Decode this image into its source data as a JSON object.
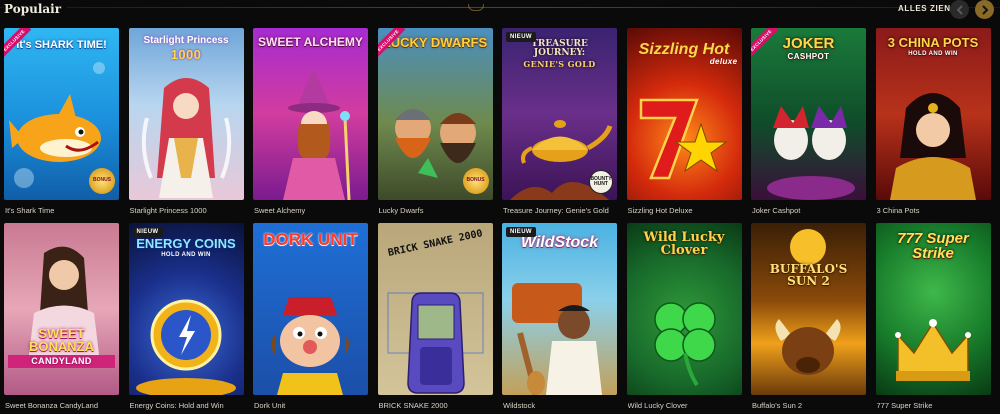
{
  "header": {
    "title": "Populair",
    "see_all_label": "ALLES ZIEN",
    "prev_icon": "chevron-left-icon",
    "next_icon": "chevron-right-icon"
  },
  "badges": {
    "exclusive": "EXCLUSIVE",
    "new": "NIEUW"
  },
  "games": [
    {
      "caption": "It's Shark Time",
      "logo": "It's SHARK TIME!",
      "extra": "BONUS"
    },
    {
      "caption": "Starlight Princess 1000",
      "logo": "Starlight Princess",
      "logo_sub": "1000"
    },
    {
      "caption": "Sweet Alchemy",
      "logo": "SWEET ALCHEMY"
    },
    {
      "caption": "Lucky Dwarfs",
      "logo": "LUCKY DWARFS",
      "extra": "BONUS"
    },
    {
      "caption": "Treasure Journey: Genie's Gold",
      "logo": "TREASURE JOURNEY:",
      "logo_sub": "GENIE'S GOLD",
      "extra": "BOUNTY HUNT"
    },
    {
      "caption": "Sizzling Hot Deluxe",
      "logo": "Sizzling Hot",
      "logo_sub": "deluxe"
    },
    {
      "caption": "Joker Cashpot",
      "logo": "JOKER",
      "logo_sub": "CASHPOT"
    },
    {
      "caption": "3 China Pots",
      "logo": "3 CHINA POTS",
      "logo_sub": "HOLD AND WIN"
    },
    {
      "caption": "Sweet Bonanza CandyLand",
      "logo": "SWEET BONANZA",
      "logo_sub": "CANDYLAND"
    },
    {
      "caption": "Energy Coins: Hold and Win",
      "logo": "ENERGY COINS",
      "logo_sub": "HOLD AND WIN"
    },
    {
      "caption": "Dork Unit",
      "logo": "DORK UNIT"
    },
    {
      "caption": "BRICK SNAKE 2000",
      "logo": "BRICK SNAKE 2000"
    },
    {
      "caption": "Wildstock",
      "logo": "WildStock"
    },
    {
      "caption": "Wild Lucky Clover",
      "logo": "Wild Lucky Clover"
    },
    {
      "caption": "Buffalo's Sun 2",
      "logo": "BUFFALO'S SUN 2"
    },
    {
      "caption": "777 Super Strike",
      "logo": "777 Super Strike"
    }
  ]
}
